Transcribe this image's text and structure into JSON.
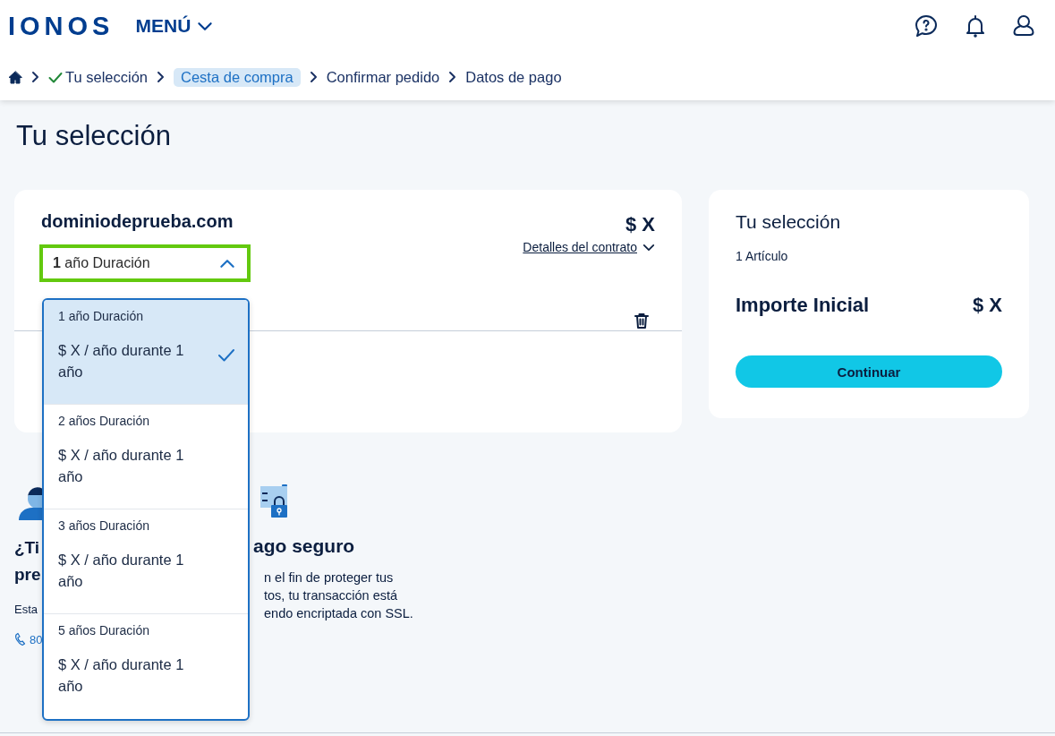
{
  "header": {
    "logo": "IONOS",
    "menu": {
      "label": "MENÚ",
      "expanded": false
    }
  },
  "breadcrumb": [
    {
      "label": "Tu selección",
      "done": true,
      "selected": false
    },
    {
      "label": "Cesta de compra",
      "done": false,
      "selected": true
    },
    {
      "label": "Confirmar pedido",
      "done": false,
      "selected": false
    },
    {
      "label": "Datos de pago",
      "done": false,
      "selected": false
    }
  ],
  "page_title": "Tu selección",
  "cart_item": {
    "domain": "dominiodeprueba.com",
    "price": "$ X",
    "contract_link": "Detalles del contrato",
    "duration_select": {
      "value": "**1** año Duración",
      "expanded": true,
      "options": [
        {
          "label": "1 año Duración",
          "price": "$ X / año durante 1 año",
          "selected": true
        },
        {
          "label": "2 años Duración",
          "price": "$ X / año durante 1 año",
          "selected": false
        },
        {
          "label": "3 años Duración",
          "price": "$ X / año durante 1 año",
          "selected": false
        },
        {
          "label": "5 años Duración",
          "price": "$ X / año durante 1 año",
          "selected": false
        }
      ]
    }
  },
  "summary": {
    "title": "Tu selección",
    "count": "1 Artículo",
    "total_label": "Importe Inicial",
    "total": "$ X",
    "button": "Continuar"
  },
  "help": {
    "title_lines": [
      "¿Ti",
      "pre"
    ],
    "text": "Esta",
    "phone": "80"
  },
  "secure": {
    "title": "ago seguro",
    "lines": [
      "n el fin de proteger tus",
      "tos, tu transacción está",
      "endo encriptada con SSL."
    ]
  }
}
